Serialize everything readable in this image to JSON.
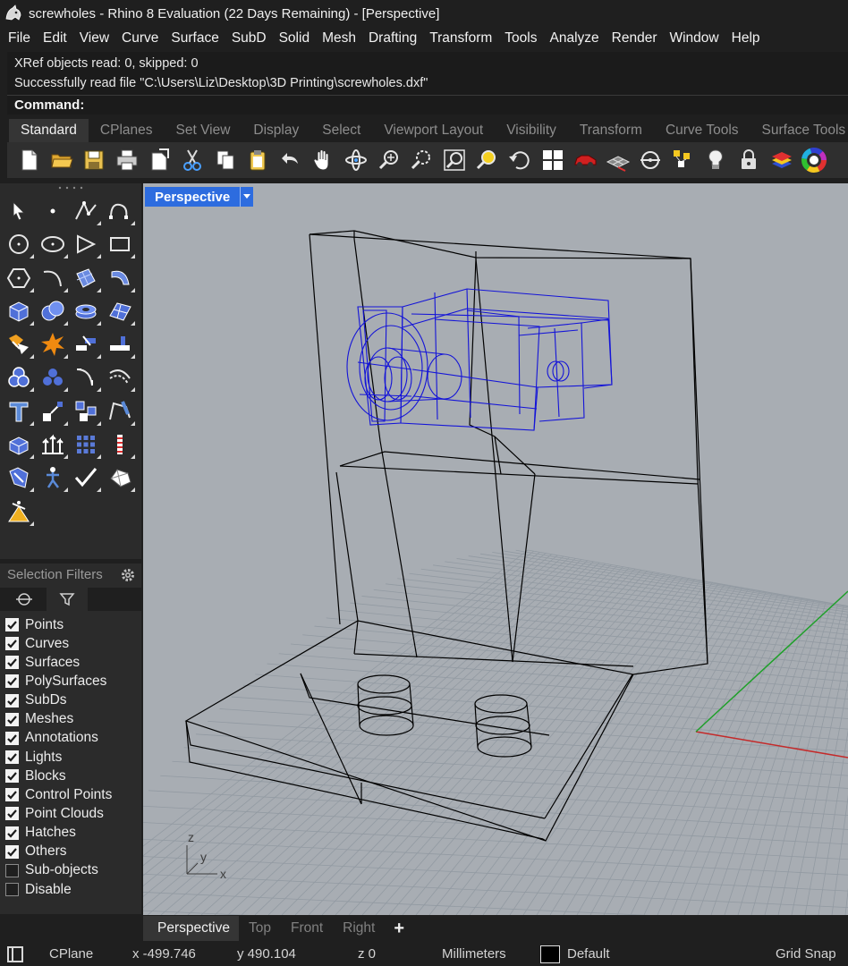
{
  "window": {
    "title": "screwholes - Rhino 8 Evaluation (22 Days Remaining) - [Perspective]"
  },
  "menu": [
    "File",
    "Edit",
    "View",
    "Curve",
    "Surface",
    "SubD",
    "Solid",
    "Mesh",
    "Drafting",
    "Transform",
    "Tools",
    "Analyze",
    "Render",
    "Window",
    "Help"
  ],
  "command": {
    "history": [
      "XRef objects read: 0, skipped: 0",
      "Successfully read file \"C:\\Users\\Liz\\Desktop\\3D Printing\\screwholes.dxf\""
    ],
    "prompt": "Command:"
  },
  "toolbar_tabs": [
    "Standard",
    "CPlanes",
    "Set View",
    "Display",
    "Select",
    "Viewport Layout",
    "Visibility",
    "Transform",
    "Curve Tools",
    "Surface Tools"
  ],
  "toolbar_icons": [
    "new-document-icon",
    "open-folder-icon",
    "save-icon",
    "print-icon",
    "import-icon",
    "cut-icon",
    "copy-icon",
    "paste-icon",
    "undo-icon",
    "pan-hand-icon",
    "rotate-view-icon",
    "zoom-icon",
    "zoom-window-icon",
    "zoom-extents-icon",
    "zoom-selected-icon",
    "undo-view-icon",
    "four-viewports-icon",
    "car-render-icon",
    "grid-plane-icon",
    "cplane-icon",
    "properties-icon",
    "light-bulb-icon",
    "lock-icon",
    "layers-icon",
    "color-wheel-icon"
  ],
  "sidebar_tools": [
    "select-arrow-icon",
    "point-icon",
    "polyline-icon",
    "curve-icon",
    "circle-icon",
    "ellipse-icon",
    "polygon-icon",
    "rectangle-icon",
    "hexagon-icon",
    "arc-icon",
    "surface-icon",
    "revolve-icon",
    "box-icon",
    "sphere-icon",
    "cylinder-icon",
    "mesh-icon",
    "boolean-union-icon",
    "explode-icon",
    "join-icon",
    "trim-icon",
    "solid-tools-icon",
    "group-icon",
    "fillet-icon",
    "offset-icon",
    "text-icon",
    "scale-icon",
    "array-icon",
    "edit-points-icon",
    "extrude-icon",
    "move-arrows-icon",
    "grid-icon",
    "dimension-icon",
    "analyze-icon",
    "human-figure-icon",
    "check-icon",
    "mesh-tools-icon",
    "render-icon"
  ],
  "selection_filters": {
    "title": "Selection Filters",
    "items": [
      {
        "label": "Points",
        "checked": true
      },
      {
        "label": "Curves",
        "checked": true
      },
      {
        "label": "Surfaces",
        "checked": true
      },
      {
        "label": "PolySurfaces",
        "checked": true
      },
      {
        "label": "SubDs",
        "checked": true
      },
      {
        "label": "Meshes",
        "checked": true
      },
      {
        "label": "Annotations",
        "checked": true
      },
      {
        "label": "Lights",
        "checked": true
      },
      {
        "label": "Blocks",
        "checked": true
      },
      {
        "label": "Control Points",
        "checked": true
      },
      {
        "label": "Point Clouds",
        "checked": true
      },
      {
        "label": "Hatches",
        "checked": true
      },
      {
        "label": "Others",
        "checked": true
      },
      {
        "label": "Sub-objects",
        "checked": false
      },
      {
        "label": "Disable",
        "checked": false
      }
    ]
  },
  "viewport": {
    "name": "Perspective",
    "axis_labels": {
      "z": "z",
      "y": "y",
      "x": "x"
    }
  },
  "view_tabs": [
    {
      "label": "Perspective",
      "active": true
    },
    {
      "label": "Top",
      "active": false
    },
    {
      "label": "Front",
      "active": false
    },
    {
      "label": "Right",
      "active": false
    }
  ],
  "add_view_label": "+",
  "status": {
    "cplane": "CPlane",
    "x": "x -499.746",
    "y": "y 490.104",
    "z": "z 0",
    "units": "Millimeters",
    "layer": "Default",
    "layer_color": "#000000",
    "grid_snap": "Grid Snap"
  },
  "colors": {
    "viewport_bg": "#a8adb3",
    "grid_line": "#8f959c",
    "wire_selected": "#1010e0",
    "x_axis": "#c42a2a",
    "y_axis": "#1fa02a",
    "active_tab": "#2d6cdf"
  }
}
